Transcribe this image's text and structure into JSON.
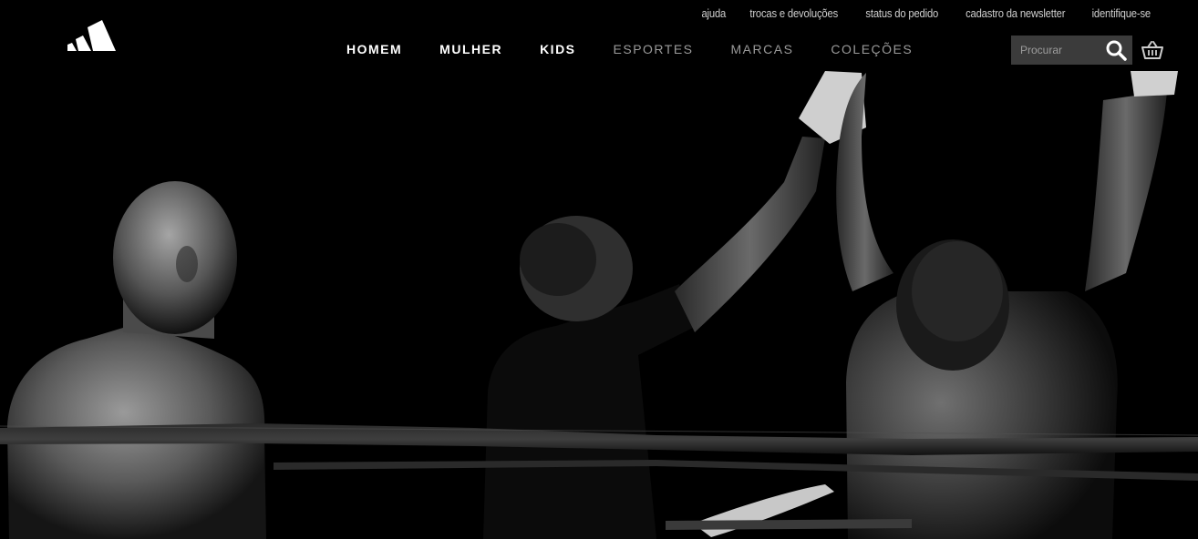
{
  "brand": {
    "logo_icon": "adidas-performance-logo"
  },
  "utility_links": [
    "ajuda",
    "trocas e devoluções",
    "status do pedido",
    "cadastro da newsletter",
    "identifique-se"
  ],
  "main_nav": {
    "primary": [
      "HOMEM",
      "MULHER",
      "KIDS"
    ],
    "secondary": [
      "ESPORTES",
      "MARCAS",
      "COLEÇÕES"
    ]
  },
  "search": {
    "placeholder": "Procurar",
    "icon": "search-icon"
  },
  "cart": {
    "icon": "basket-icon"
  },
  "colors": {
    "background": "#000000",
    "search_bg": "#3b3b3b",
    "nav_primary": "#ffffff",
    "nav_secondary": "#9a9a9a"
  }
}
